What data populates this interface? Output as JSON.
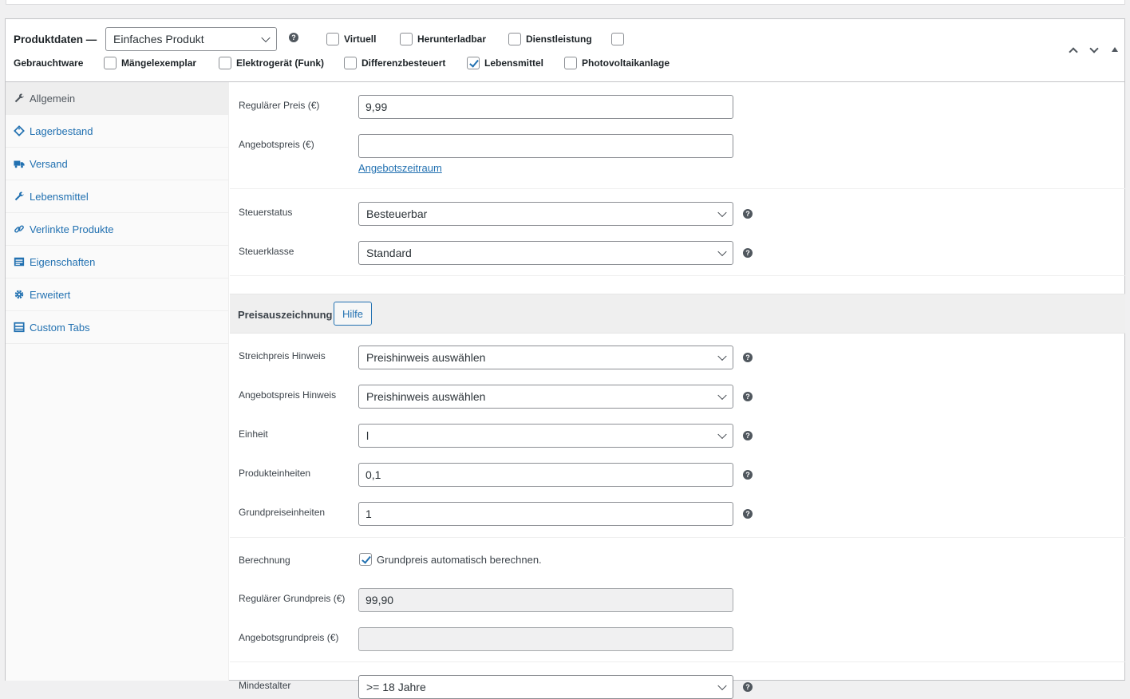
{
  "header": {
    "title": "Produktdaten —",
    "product_type": "Einfaches Produkt",
    "help": "?",
    "options": [
      {
        "label": "Virtuell",
        "checked": false
      },
      {
        "label": "Herunterladbar",
        "checked": false
      },
      {
        "label": "Dienstleistung",
        "checked": false
      },
      {
        "label": "Gebrauchtware",
        "checked": false
      },
      {
        "label": "Mängelexemplar",
        "checked": false
      },
      {
        "label": "Elektrogerät (Funk)",
        "checked": false
      },
      {
        "label": "Differenzbesteuert",
        "checked": false
      },
      {
        "label": "Lebensmittel",
        "checked": true
      },
      {
        "label": "Photovoltaikanlage",
        "checked": false
      }
    ]
  },
  "sidebar": {
    "items": [
      {
        "label": "Allgemein",
        "icon": "wrench-icon",
        "active": true
      },
      {
        "label": "Lagerbestand",
        "icon": "tag-icon",
        "active": false
      },
      {
        "label": "Versand",
        "icon": "truck-icon",
        "active": false
      },
      {
        "label": "Lebensmittel",
        "icon": "wrench-icon",
        "active": false
      },
      {
        "label": "Verlinkte Produkte",
        "icon": "link-icon",
        "active": false
      },
      {
        "label": "Eigenschaften",
        "icon": "list-icon",
        "active": false
      },
      {
        "label": "Erweitert",
        "icon": "gear-icon",
        "active": false
      },
      {
        "label": "Custom Tabs",
        "icon": "tabs-icon",
        "active": false
      }
    ]
  },
  "pricing": {
    "regular_label": "Regulärer Preis (€)",
    "regular_value": "9,99",
    "sale_label": "Angebotspreis (€)",
    "sale_value": "",
    "schedule_link": "Angebotszeitraum"
  },
  "tax": {
    "status_label": "Steuerstatus",
    "status_value": "Besteuerbar",
    "class_label": "Steuerklasse",
    "class_value": "Standard"
  },
  "price_label_section": {
    "title": "Preisauszeichnung",
    "help_button": "Hilfe",
    "strike_label": "Streichpreis Hinweis",
    "strike_value": "Preishinweis auswählen",
    "sale_notice_label": "Angebotspreis Hinweis",
    "sale_notice_value": "Preishinweis auswählen",
    "unit_label": "Einheit",
    "unit_value": "l",
    "product_units_label": "Produkteinheiten",
    "product_units_value": "0,1",
    "base_units_label": "Grundpreiseinheiten",
    "base_units_value": "1"
  },
  "calculation": {
    "label": "Berechnung",
    "checkbox_label": "Grundpreis automatisch berechnen.",
    "checked": true,
    "regular_base_label": "Regulärer Grundpreis (€)",
    "regular_base_value": "99,90",
    "sale_base_label": "Angebotsgrundpreis (€)",
    "sale_base_value": ""
  },
  "age": {
    "label": "Mindestalter",
    "value": ">= 18 Jahre"
  }
}
